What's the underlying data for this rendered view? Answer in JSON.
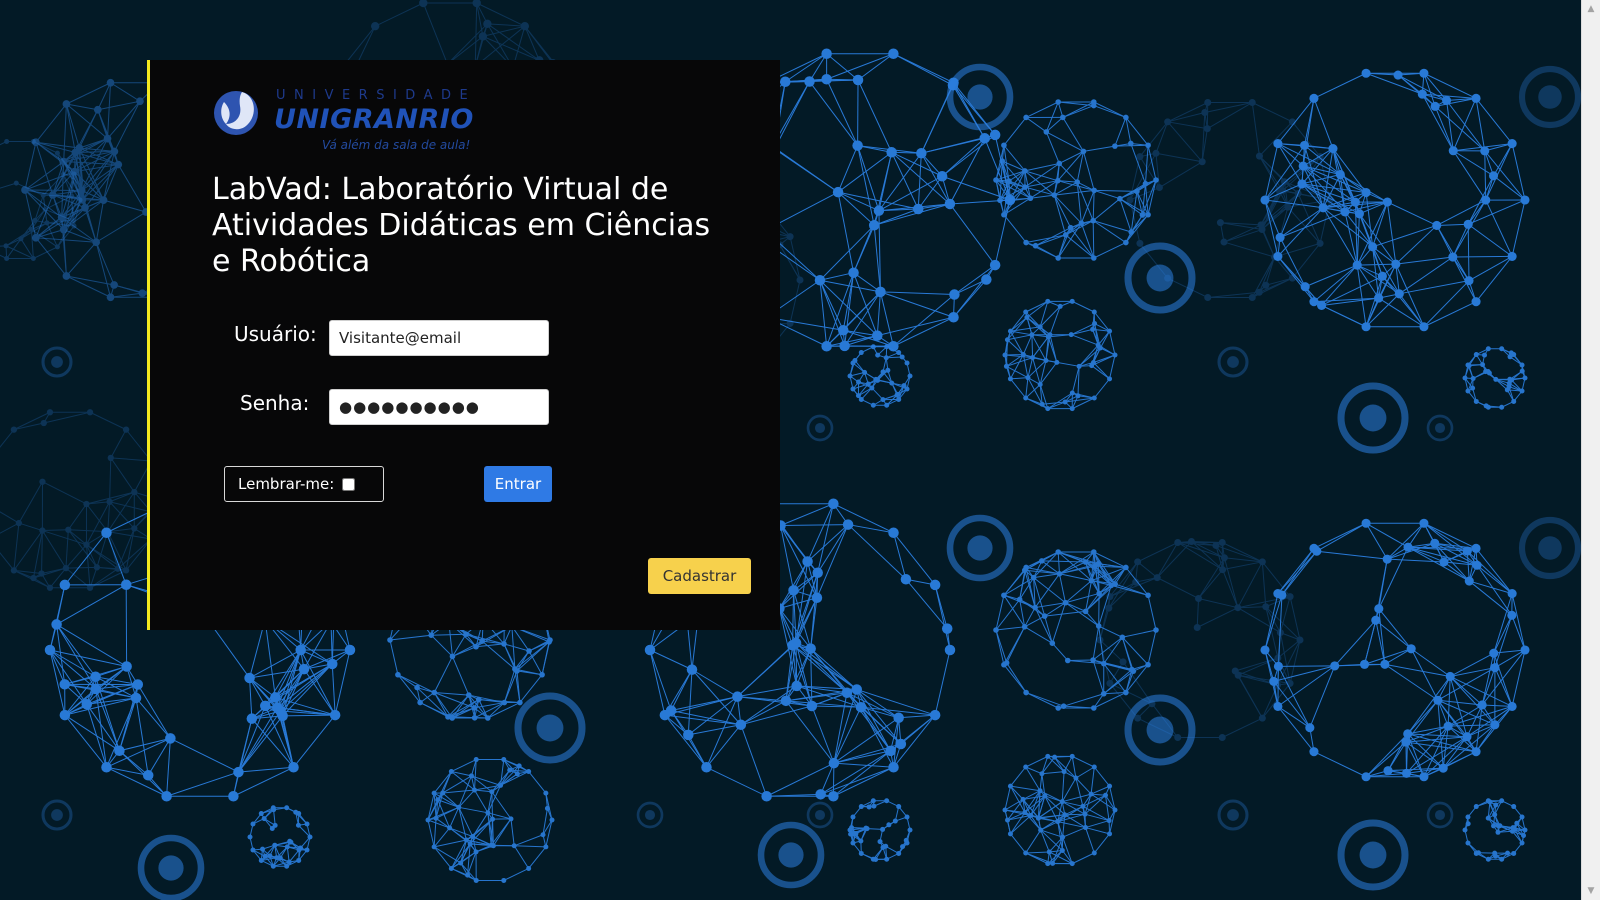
{
  "theme": {
    "page_background": "#031a26",
    "network_color": "#2b7fe0",
    "card_background": "#070708",
    "card_accent_border": "#f3ea1f",
    "primary_button": "#2f7ae5",
    "secondary_button": "#f7d14c"
  },
  "logo": {
    "icon": "unigranrio-logo-icon",
    "line1": "UNIVERSIDADE",
    "line2": "UNIGRANRIO",
    "tagline": "Vá além da sala de aula!"
  },
  "page_title": "LabVad: Laboratório Virtual de Atividades Didáticas em Ciências e Robótica",
  "form": {
    "username_label": "Usuário:",
    "username_value": "Visitante@email",
    "password_label": "Senha:",
    "password_value": "●●●●●●●●●●",
    "remember_label": "Lembrar-me:",
    "remember_checked": false,
    "submit_label": "Entrar"
  },
  "register_label": "Cadastrar",
  "scrollbar": {
    "up_icon": "scroll-up-arrow-icon",
    "down_icon": "scroll-down-arrow-icon"
  }
}
